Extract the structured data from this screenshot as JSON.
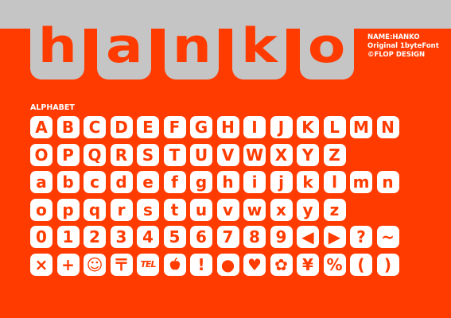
{
  "logo": {
    "letters": [
      "h",
      "a",
      "n",
      "k",
      "o"
    ]
  },
  "info": {
    "name": "NAME:HANKO",
    "line2": "Original 1byteFont",
    "line3": "©FLOP DESIGN"
  },
  "section_label": "ALPHABET",
  "rows": [
    [
      "A",
      "B",
      "C",
      "D",
      "E",
      "F",
      "G",
      "H",
      "I",
      "J",
      "K",
      "L",
      "M",
      "N"
    ],
    [
      "O",
      "P",
      "Q",
      "R",
      "S",
      "T",
      "U",
      "V",
      "W",
      "X",
      "Y",
      "Z",
      "",
      ""
    ],
    [
      "a",
      "b",
      "c",
      "d",
      "e",
      "f",
      "g",
      "h",
      "i",
      "j",
      "k",
      "l",
      "m",
      "n"
    ],
    [
      "o",
      "p",
      "q",
      "r",
      "s",
      "t",
      "u",
      "v",
      "w",
      "x",
      "y",
      "z",
      "",
      ""
    ],
    [
      "0",
      "1",
      "2",
      "3",
      "4",
      "5",
      "6",
      "7",
      "8",
      "9",
      "◀",
      "▶",
      "?",
      "~"
    ],
    [
      "×",
      "+",
      "☺",
      "〒",
      "TEL",
      "",
      "!",
      "●",
      "♥",
      "✿",
      "¥",
      "%",
      "&",
      "☺"
    ]
  ],
  "last_row_extra": [
    "(",
    ")"
  ],
  "colors": {
    "background": "#ff3b00",
    "band": "#c5c5c5",
    "tile": "#ffffff"
  }
}
